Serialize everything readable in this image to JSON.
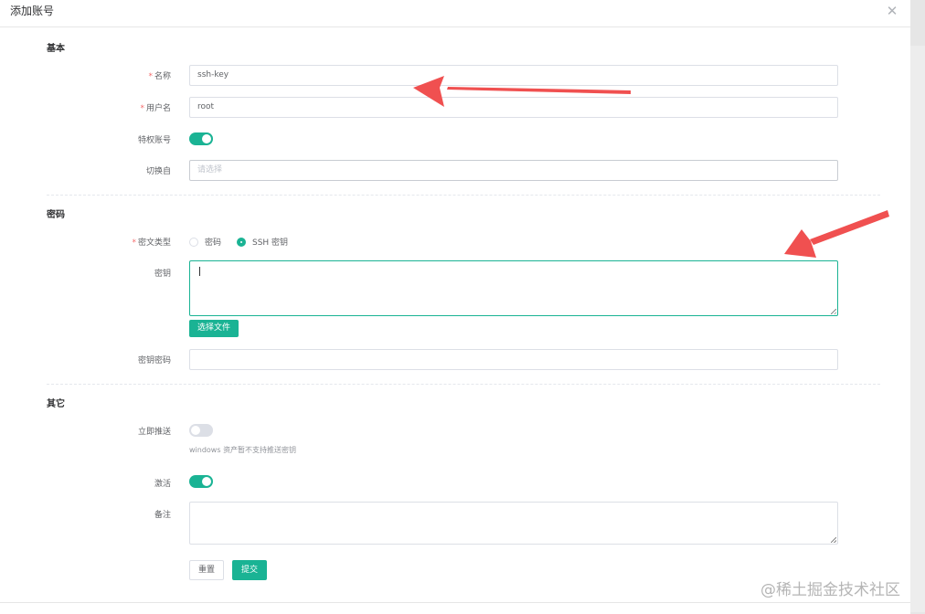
{
  "dialog": {
    "title": "添加账号",
    "close_icon": "close-icon"
  },
  "sections": {
    "basic": "基本",
    "password": "密码",
    "other": "其它"
  },
  "fields": {
    "name": {
      "required": "*",
      "label": "名称",
      "value": "ssh-key"
    },
    "username": {
      "required": "*",
      "label": "用户名",
      "value": "root"
    },
    "privileged": {
      "label": "特权账号",
      "on": true
    },
    "switch_from": {
      "label": "切换自",
      "placeholder": "请选择"
    },
    "secret_type": {
      "required": "*",
      "label": "密文类型",
      "options": [
        "密码",
        "SSH 密钥"
      ],
      "selected": "SSH 密钥"
    },
    "private_key": {
      "label": "密钥",
      "value": "",
      "choose_file": "选择文件"
    },
    "key_password": {
      "label": "密钥密码",
      "value": ""
    },
    "push_now": {
      "label": "立即推送",
      "on": false,
      "hint": "windows 资产暂不支持推送密钥"
    },
    "active": {
      "label": "激活",
      "on": true
    },
    "comment": {
      "label": "备注",
      "value": ""
    }
  },
  "buttons": {
    "reset": "重置",
    "submit": "提交"
  },
  "colors": {
    "accent": "#1ab394",
    "required": "#f56c6c",
    "annotation_arrow": "#f05050"
  },
  "watermark": "@稀土掘金技术社区"
}
